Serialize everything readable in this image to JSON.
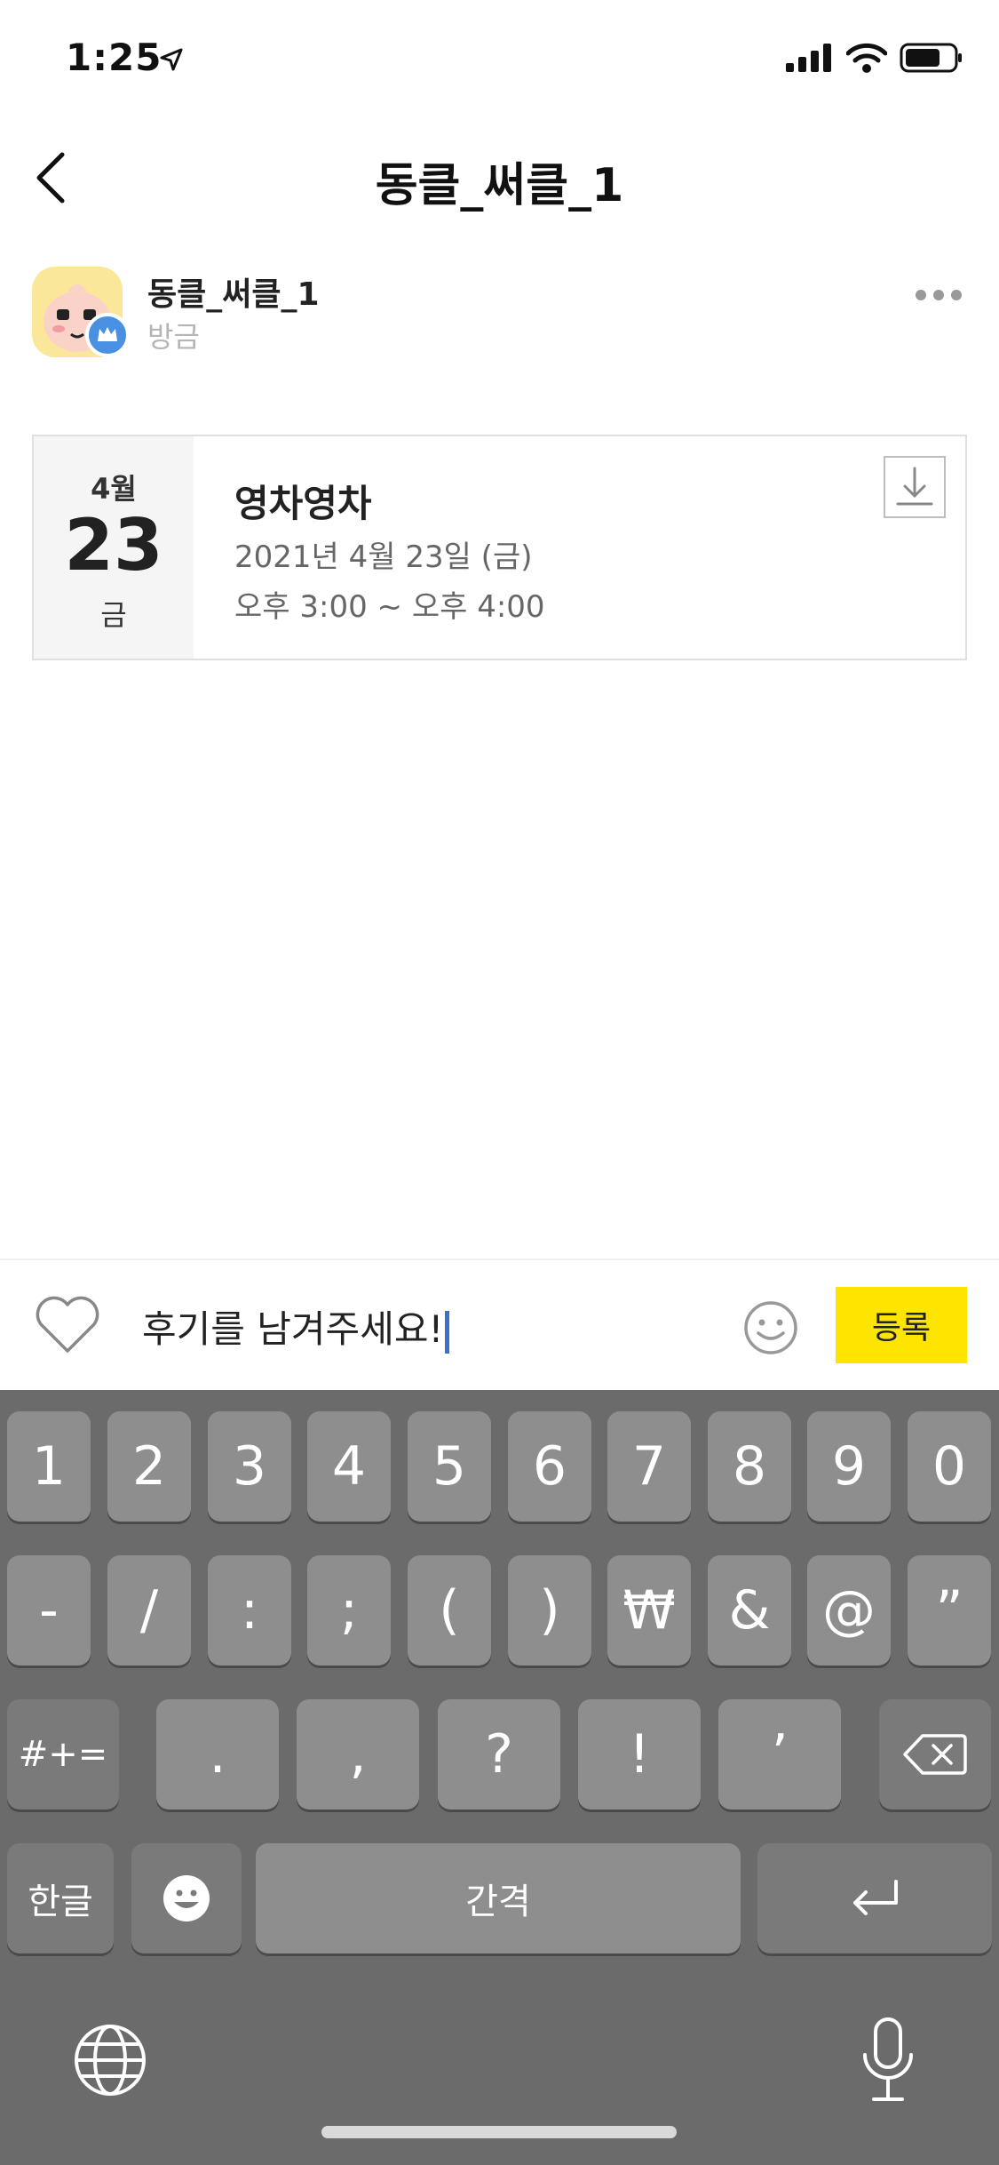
{
  "status_bar": {
    "time": "1:25"
  },
  "nav": {
    "title": "동클_써클_1"
  },
  "post": {
    "author_name": "동클_써클_1",
    "timestamp": "방금"
  },
  "event": {
    "month": "4월",
    "day": "23",
    "weekday": "금",
    "title": "영차영차",
    "date": "2021년 4월 23일 (금)",
    "time": "오후 3:00 ~ 오후 4:00"
  },
  "comment": {
    "value": "후기를 남겨주세요!",
    "submit_label": "등록"
  },
  "keyboard": {
    "row1": [
      "1",
      "2",
      "3",
      "4",
      "5",
      "6",
      "7",
      "8",
      "9",
      "0"
    ],
    "row2": [
      "-",
      "/",
      ":",
      ";",
      "(",
      ")",
      "₩",
      "&",
      "@",
      "”"
    ],
    "row3": [
      ".",
      ",",
      "?",
      "!",
      "’"
    ],
    "mode_key": "#+=",
    "lang_key": "한글",
    "space_key": "간격"
  },
  "colors": {
    "accent": "#fee500",
    "badge": "#4a90e2",
    "keyboard_bg": "#6b6b6b"
  }
}
